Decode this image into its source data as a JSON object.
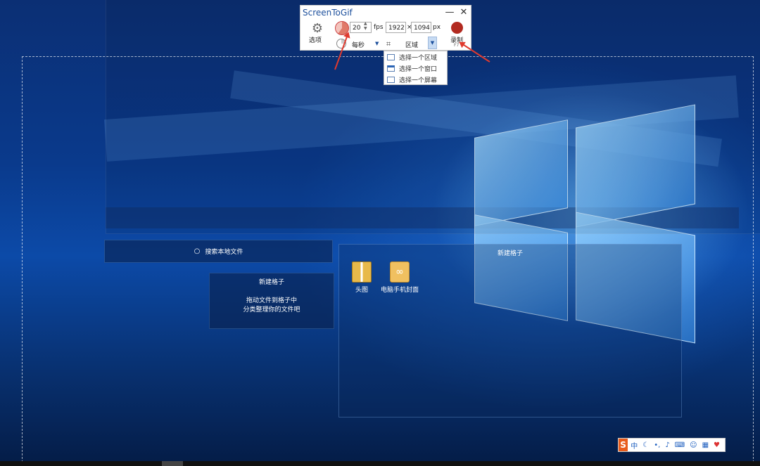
{
  "app": {
    "title": "ScreenToGif",
    "minimize_glyph": "—",
    "close_glyph": "✕",
    "options_label": "选项",
    "fps_value": "20",
    "fps_unit": "fps",
    "width_value": "1922",
    "times": "×",
    "height_value": "1094",
    "px_unit": "px",
    "frequency_label": "每秒",
    "mode_label": "区域",
    "record_label": "录制",
    "record_shortcut": "F7"
  },
  "mode_menu": {
    "items": [
      {
        "label": "选择一个区域",
        "icon": "crop-region-icon"
      },
      {
        "label": "选择一个窗口",
        "icon": "window-icon"
      },
      {
        "label": "选择一个屏幕",
        "icon": "monitor-icon"
      }
    ]
  },
  "desktop": {
    "search_placeholder": "搜索本地文件",
    "fence_small": {
      "title": "新建格子",
      "desc_line1": "拖动文件到格子中",
      "desc_line2": "分类整理你的文件吧"
    },
    "fence_big": {
      "title": "新建格子",
      "icons": [
        {
          "label": "头图",
          "icon": "folder-icon"
        },
        {
          "label": "电脑手机封面",
          "icon": "image-file-icon"
        }
      ]
    }
  },
  "ime": {
    "logo": "S",
    "mode": "中",
    "items": [
      "moon-icon",
      "punctuation-icon",
      "mic-icon",
      "keyboard-icon",
      "user-icon",
      "grid-icon",
      "skin-icon"
    ]
  },
  "colors": {
    "record": "#b22a20",
    "title": "#1c4f9c",
    "arrow": "#e03a2e"
  }
}
